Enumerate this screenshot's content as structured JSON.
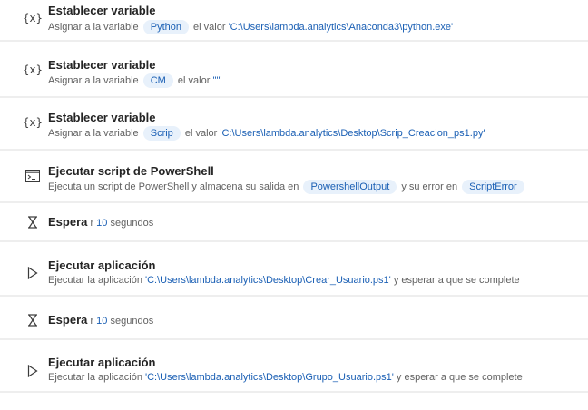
{
  "steps": [
    {
      "icon": "variable-icon",
      "title": "Establecer variable",
      "desc": {
        "pre": "Asignar a la variable",
        "var": "Python",
        "mid": "el valor",
        "value": "'C:\\Users\\lambda.analytics\\Anaconda3\\python.exe'"
      }
    },
    {
      "icon": "variable-icon",
      "title": "Establecer variable",
      "desc": {
        "pre": "Asignar a la variable",
        "var": "CM",
        "mid": "el valor",
        "value": "'\"'"
      }
    },
    {
      "icon": "variable-icon",
      "title": "Establecer variable",
      "desc": {
        "pre": "Asignar a la variable",
        "var": "Scrip",
        "mid": "el valor",
        "value": "'C:\\Users\\lambda.analytics\\Desktop\\Scrip_Creacion_ps1.py'"
      }
    },
    {
      "icon": "powershell-icon",
      "title": "Ejecutar script de PowerShell",
      "desc": {
        "pre": "Ejecuta un script de PowerShell y almacena su salida en",
        "var": "PowershellOutput",
        "mid": "y su error en",
        "var2": "ScriptError"
      }
    },
    {
      "icon": "hourglass-icon",
      "title": "Espera",
      "desc": {
        "pre": "r",
        "value": "10",
        "post": "segundos"
      }
    },
    {
      "icon": "play-icon",
      "title": "Ejecutar aplicación",
      "desc": {
        "pre": "Ejecutar la aplicación",
        "value": "'C:\\Users\\lambda.analytics\\Desktop\\Crear_Usuario.ps1'",
        "post": "y esperar a que se complete"
      }
    },
    {
      "icon": "hourglass-icon",
      "title": "Espera",
      "desc": {
        "pre": "r",
        "value": "10",
        "post": "segundos"
      }
    },
    {
      "icon": "play-icon",
      "title": "Ejecutar aplicación",
      "desc": {
        "pre": "Ejecutar la aplicación",
        "value": "'C:\\Users\\lambda.analytics\\Desktop\\Grupo_Usuario.ps1'",
        "post": "y esperar a que se complete"
      }
    }
  ],
  "icons": {
    "variable": "{x}",
    "powershell": ">_",
    "hourglass": "⧗",
    "play": "▷"
  },
  "colors": {
    "accent": "#1a5fb4",
    "pill_bg": "#e8f1fb",
    "divider": "#eeeeee"
  }
}
